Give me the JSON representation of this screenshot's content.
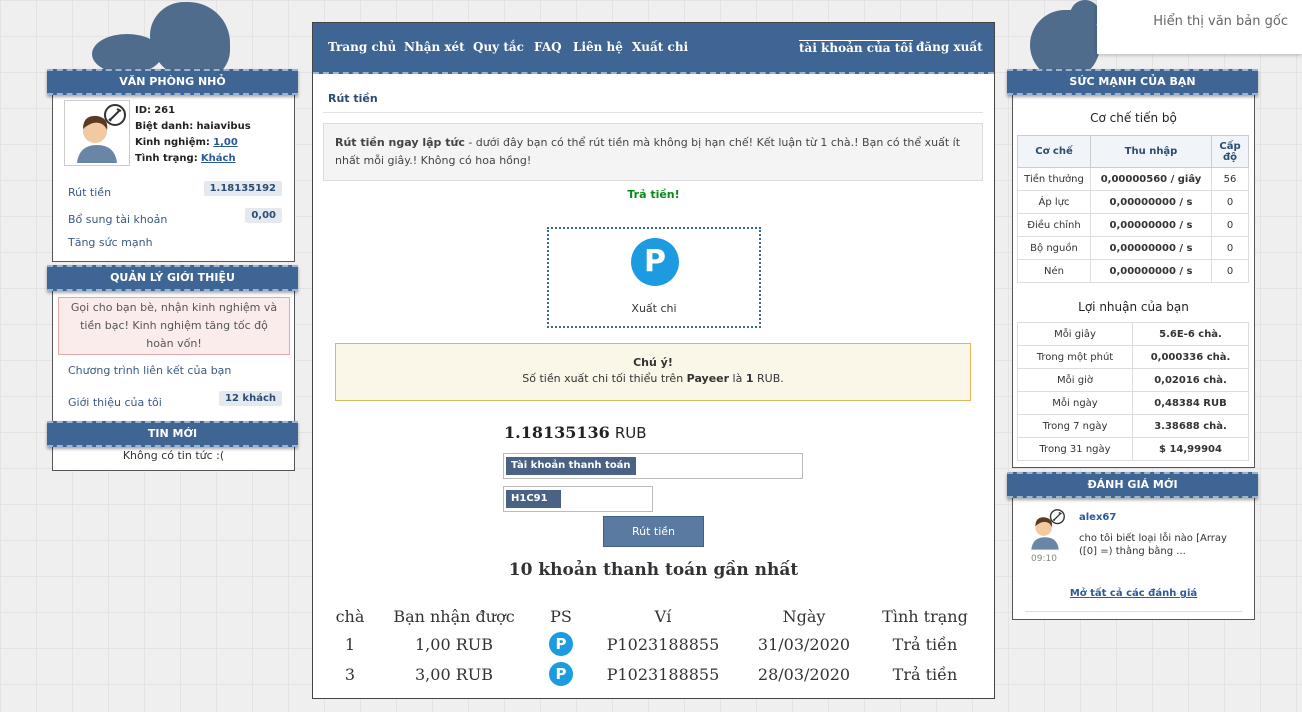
{
  "translate_popup": {
    "label": "Hiển thị văn bản gốc"
  },
  "nav": {
    "home": "Trang chủ",
    "reviews": "Nhận xét",
    "rules": "Quy tắc",
    "faq": "FAQ",
    "contact": "Liên hệ",
    "payout": "Xuất chi",
    "my_account": "tài khoản của tôi",
    "logout": "đăng xuất"
  },
  "office": {
    "title": "VĂN PHÒNG NHỎ",
    "id_label": "ID:",
    "id_value": "261",
    "nick_label": "Biệt danh:",
    "nick_value": "haiavibus",
    "exp_label": "Kinh nghiệm:",
    "exp_value": "1,00",
    "status_label": "Tình trạng:",
    "status_value": "Khách",
    "withdraw_label": "Rút tiền",
    "withdraw_value": "1.18135192",
    "topup_label": "Bổ sung tài khoản",
    "topup_value": "0,00",
    "power_link": "Tăng sức mạnh"
  },
  "referral": {
    "title": "QUẢN LÝ GIỚI THIỆU",
    "notice": "Gọi cho bạn bè, nhận kinh nghiệm và tiền bạc! Kinh nghiệm tăng tốc độ hoàn vốn!",
    "program_link": "Chương trình liên kết của bạn",
    "my_refs_label": "Giới thiệu của tôi",
    "my_refs_value": "12 khách"
  },
  "news": {
    "title": "TIN MỚI",
    "empty": "Không có tin tức :("
  },
  "main": {
    "breadcrumb": "Rút tiền",
    "info_bold": "Rút tiền ngay lập tức",
    "info_text": " - dưới đây bạn có thể rút tiền mà không bị hạn chế! Kết luận từ 1 chà.! Bạn có thể xuất ít nhất mỗi giây.! Không có hoa hồng!",
    "pay_status": "Trả tiền!",
    "payment_system_letter": "P",
    "payment_label": "Xuất chi",
    "notice_title": "Chú ý!",
    "notice_prefix": "Số tiền xuất chi tối thiểu trên ",
    "notice_system": "Payeer",
    "notice_mid": " là ",
    "notice_amount": "1",
    "notice_suffix": " RUB.",
    "balance_value": "1.18135136",
    "balance_unit": "RUB",
    "account_label": "Tài khoản thanh toán",
    "account_value": "",
    "captcha": "H1C91",
    "captcha_value": "",
    "submit": "Rút tiền",
    "recent_title": "10 khoản thanh toán gần nhất",
    "columns": [
      "chà",
      "Bạn nhận được",
      "PS",
      "Ví",
      "Ngày",
      "Tình trạng"
    ],
    "rows": [
      {
        "cha": "1",
        "received": "1,00 RUB",
        "ps": "P",
        "wallet": "P1023188855",
        "date": "31/03/2020",
        "status": "Trả tiền"
      },
      {
        "cha": "3",
        "received": "3,00 RUB",
        "ps": "P",
        "wallet": "P1023188855",
        "date": "28/03/2020",
        "status": "Trả tiền"
      }
    ]
  },
  "power": {
    "title": "SỨC MẠNH CỦA BẠN",
    "mech_title": "Cơ chế tiến bộ",
    "mech_cols": [
      "Cơ chế",
      "Thu nhập",
      "Cấp độ"
    ],
    "mech_rows": [
      {
        "name": "Tiền thưởng",
        "income": "0,00000560 / giây",
        "level": "56"
      },
      {
        "name": "Áp lực",
        "income": "0,00000000 / s",
        "level": "0"
      },
      {
        "name": "Điều chỉnh",
        "income": "0,00000000 / s",
        "level": "0"
      },
      {
        "name": "Bộ nguồn",
        "income": "0,00000000 / s",
        "level": "0"
      },
      {
        "name": "Nén",
        "income": "0,00000000 / s",
        "level": "0"
      }
    ],
    "profit_title": "Lợi nhuận của bạn",
    "profit_rows": [
      {
        "period": "Mỗi giây",
        "value": "5.6E-6 chà."
      },
      {
        "period": "Trong một phút",
        "value": "0,000336 chà."
      },
      {
        "period": "Mỗi giờ",
        "value": "0,02016 chà."
      },
      {
        "period": "Mỗi ngày",
        "value": "0,48384 RUB"
      },
      {
        "period": "Trong 7 ngày",
        "value": "3.38688 chà."
      },
      {
        "period": "Trong 31 ngày",
        "value": "$ 14,99904"
      }
    ]
  },
  "reviews": {
    "title": "ĐÁNH GIÁ MỚI",
    "user": "alex67",
    "time": "09:10",
    "text": "cho tôi biết loại lỗi nào [Array ([0] =) thằng bằng ...",
    "open_all": "Mở tất cả các đánh giá"
  },
  "colors": {
    "brand": "#3f6594",
    "payeer": "#1c9be0",
    "success": "#0a8a1a"
  }
}
